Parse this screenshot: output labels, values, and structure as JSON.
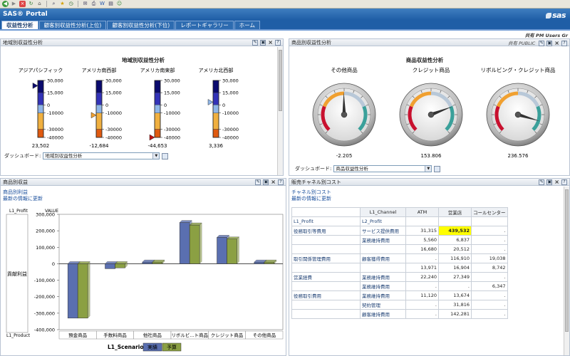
{
  "browser": {
    "icons": [
      "back-icon",
      "forward-icon",
      "stop-icon",
      "refresh-icon",
      "home-icon",
      "search-icon",
      "favorites-icon",
      "history-icon",
      "mail-icon",
      "print-icon",
      "edit-icon",
      "discuss-icon",
      "messenger-icon"
    ]
  },
  "header": {
    "title": "SAS® Portal",
    "logo": "sas"
  },
  "tabs": [
    {
      "label": "収益性分析",
      "active": true
    },
    {
      "label": "顧客別収益性分析(上位)",
      "active": false
    },
    {
      "label": "顧客別収益性分析(下位)",
      "active": false
    },
    {
      "label": "レポートギャラリー",
      "active": false
    },
    {
      "label": "ホーム",
      "active": false
    }
  ],
  "share_line": "共有 PM Users Gr",
  "regional": {
    "title": "地域別収益性分析",
    "chart_title": "地域別収益性分析",
    "dashboard_label": "ダッシュボード:",
    "dashboard_value": "地域別収益性分析",
    "chart_data": {
      "type": "thermometer",
      "scale": [
        30000,
        15000,
        0,
        -10000,
        -30000,
        -40000
      ],
      "scale_labels": [
        "30,000",
        "15,000",
        "0",
        "-10000",
        "-30000",
        "-40000"
      ],
      "items": [
        {
          "name": "アジアパシフィック",
          "value": 23502,
          "label": "23,502"
        },
        {
          "name": "アメリカ南西部",
          "value": -12684,
          "label": "-12,684"
        },
        {
          "name": "アメリカ南東部",
          "value": -44653,
          "label": "-44,653"
        },
        {
          "name": "アメリカ北西部",
          "value": 3336,
          "label": "3,336"
        }
      ],
      "colors": [
        "#0a0a6e",
        "#3333b8",
        "#8fb6e8",
        "#f0b040",
        "#e05a10",
        "#c01010"
      ]
    }
  },
  "products": {
    "title": "商品別収益性分析",
    "share": "共有 PUBLIC",
    "chart_title": "商品収益性分析",
    "dashboard_label": "ダッシュボード:",
    "dashboard_value": "商品収益性分析",
    "chart_data": {
      "type": "gauge",
      "items": [
        {
          "name": "その他商品",
          "value": -2205,
          "label": "-2,205"
        },
        {
          "name": "クレジット商品",
          "value": 153806,
          "label": "153,806"
        },
        {
          "name": "リボルビング・クレジット商品",
          "value": 236576,
          "label": "236,576"
        }
      ]
    }
  },
  "profit_chart": {
    "title": "商品別収益",
    "link1": "商品別利益",
    "link2": "最新の情報に更新",
    "yaxis_label": "貢献利益",
    "row_label": "L1_Profit",
    "value_label": "VALUE",
    "product_label": "L1_Product",
    "scenario_label": "L1_Scenario",
    "legend": [
      {
        "name": "実績",
        "color": "#5a6fb0"
      },
      {
        "name": "予算",
        "color": "#8ba043"
      }
    ],
    "chart_data": {
      "type": "bar",
      "categories": [
        "預金商品",
        "手数料商品",
        "他社商品",
        "リボルビ...ト商品",
        "クレジット商品",
        "その他商品"
      ],
      "series": [
        {
          "name": "実績",
          "values": [
            -330000,
            -30000,
            10000,
            250000,
            160000,
            10000
          ]
        },
        {
          "name": "予算",
          "values": [
            -330000,
            -25000,
            10000,
            235000,
            150000,
            10000
          ]
        }
      ],
      "ylim": [
        -400000,
        300000
      ],
      "yticks": [
        300000,
        200000,
        100000,
        0,
        -100000,
        -200000,
        -300000,
        -400000
      ],
      "ytick_labels": [
        "300,000",
        "200,000",
        "100,000",
        "0",
        "-100,000",
        "-200,000",
        "-300,000",
        "-400,000"
      ]
    }
  },
  "channel": {
    "title": "販売チャネル別コスト",
    "link1": "チャネル別コスト",
    "link2": "最新の情報に更新",
    "chart_data": {
      "type": "table",
      "corner_label": "L1_Channel",
      "l1_header": "L1_Profit",
      "l2_header": "L2_Profit",
      "columns": [
        "ATM",
        "営業店",
        "コールセンター"
      ],
      "rows": [
        {
          "l1": "役務取引等費用",
          "l2": "サービス提供費用",
          "values": [
            "31,315",
            "439,532",
            "."
          ]
        },
        {
          "l1": "",
          "l2": "業務維持費用",
          "values": [
            "5,560",
            "6,837",
            "."
          ]
        },
        {
          "l1": "",
          "l2": "",
          "values": [
            "16,680",
            "20,512",
            "."
          ]
        },
        {
          "l1": "取引関係管理費用",
          "l2": "顧客獲得費用",
          "values": [
            ".",
            "116,910",
            "19,038"
          ]
        },
        {
          "l1": "",
          "l2": "",
          "values": [
            "13,971",
            "16,904",
            "8,742"
          ]
        },
        {
          "l1": "営業経費",
          "l2": "業務維持費用",
          "values": [
            "22,240",
            "27,349",
            "."
          ]
        },
        {
          "l1": "",
          "l2": "業務維持費用",
          "values": [
            ".",
            ".",
            "6,347"
          ]
        },
        {
          "l1": "役務取引費用",
          "l2": "業務維持費用",
          "values": [
            "11,120",
            "13,674",
            "."
          ]
        },
        {
          "l1": "",
          "l2": "契約管理",
          "values": [
            ".",
            "31,816",
            "."
          ]
        },
        {
          "l1": "",
          "l2": "顧客維持費用",
          "values": [
            ".",
            "142,281",
            "."
          ]
        }
      ]
    }
  }
}
